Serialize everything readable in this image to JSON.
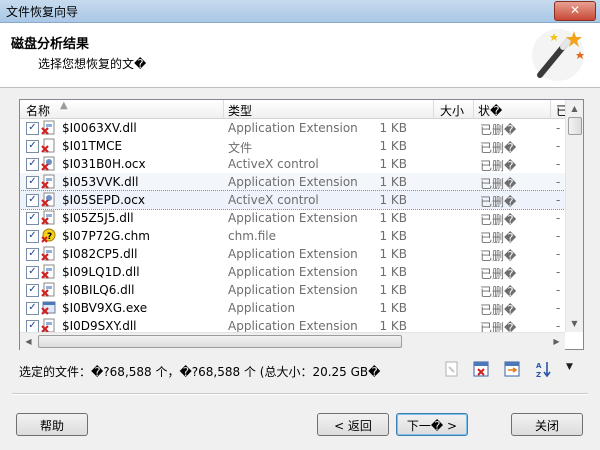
{
  "window": {
    "title": "文件恢复向导",
    "close_label": "✕"
  },
  "header": {
    "title": "磁盘分析结果",
    "subtitle": "选择您想恢复的文�"
  },
  "list": {
    "columns": {
      "name": "名称",
      "type": "类型",
      "size": "大小",
      "status": "状�",
      "extra": "已修"
    },
    "rows": [
      {
        "name": "$I0063XV.dll",
        "type": "Application Extension",
        "size": "1 KB",
        "status": "已删�",
        "icon": "dll-deleted-icon"
      },
      {
        "name": "$I01TMCE",
        "type": "文件",
        "size": "1 KB",
        "status": "已删�",
        "icon": "file-deleted-icon"
      },
      {
        "name": "$I031B0H.ocx",
        "type": "ActiveX control",
        "size": "1 KB",
        "status": "已删�",
        "icon": "ocx-deleted-icon"
      },
      {
        "name": "$I053VVK.dll",
        "type": "Application Extension",
        "size": "1 KB",
        "status": "已删�",
        "icon": "dll-deleted-icon"
      },
      {
        "name": "$I05SEPD.ocx",
        "type": "ActiveX control",
        "size": "1 KB",
        "status": "已删�",
        "icon": "ocx-deleted-icon"
      },
      {
        "name": "$I05Z5J5.dll",
        "type": "Application Extension",
        "size": "1 KB",
        "status": "已删�",
        "icon": "dll-deleted-icon"
      },
      {
        "name": "$I07P72G.chm",
        "type": "chm.file",
        "size": "1 KB",
        "status": "已删�",
        "icon": "chm-deleted-icon"
      },
      {
        "name": "$I082CP5.dll",
        "type": "Application Extension",
        "size": "1 KB",
        "status": "已删�",
        "icon": "dll-deleted-icon"
      },
      {
        "name": "$I09LQ1D.dll",
        "type": "Application Extension",
        "size": "1 KB",
        "status": "已删�",
        "icon": "dll-deleted-icon"
      },
      {
        "name": "$I0BILQ6.dll",
        "type": "Application Extension",
        "size": "1 KB",
        "status": "已删�",
        "icon": "dll-deleted-icon"
      },
      {
        "name": "$I0BV9XG.exe",
        "type": "Application",
        "size": "1 KB",
        "status": "已删�",
        "icon": "exe-deleted-icon"
      },
      {
        "name": "$I0D9SXY.dll",
        "type": "Application Extension",
        "size": "1 KB",
        "status": "已删�",
        "icon": "dll-deleted-icon"
      }
    ]
  },
  "status_text": "选定的文件：�?68,588 个，�?68,588 个 (总大小：20.25 GB�",
  "buttons": {
    "help": "帮助",
    "back": "< 返回",
    "next": "下一� >",
    "close": "关闭"
  },
  "colors": {
    "accent": "#3c7fb1",
    "deleted_red": "#d02020"
  }
}
